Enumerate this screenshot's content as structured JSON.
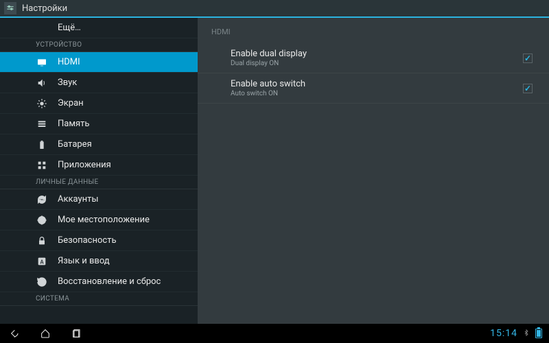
{
  "titlebar": {
    "title": "Настройки"
  },
  "sidebar": {
    "more_label": "Ещё…",
    "section_device": "УСТРОЙСТВО",
    "section_personal": "ЛИЧНЫЕ ДАННЫЕ",
    "section_system": "СИСТЕМА",
    "items": {
      "hdmi": "HDMI",
      "sound": "Звук",
      "screen": "Экран",
      "memory": "Память",
      "battery": "Батарея",
      "apps": "Приложения",
      "accounts": "Аккаунты",
      "location": "Мое местоположение",
      "security": "Безопасность",
      "lang": "Язык и ввод",
      "reset": "Восстановление и сброс"
    }
  },
  "main": {
    "header": "HDMI",
    "settings": [
      {
        "title": "Enable dual display",
        "sub": "Dual display ON",
        "checked": true
      },
      {
        "title": "Enable auto switch",
        "sub": "Auto switch ON",
        "checked": true
      }
    ]
  },
  "statusbar": {
    "time": "15:14"
  }
}
